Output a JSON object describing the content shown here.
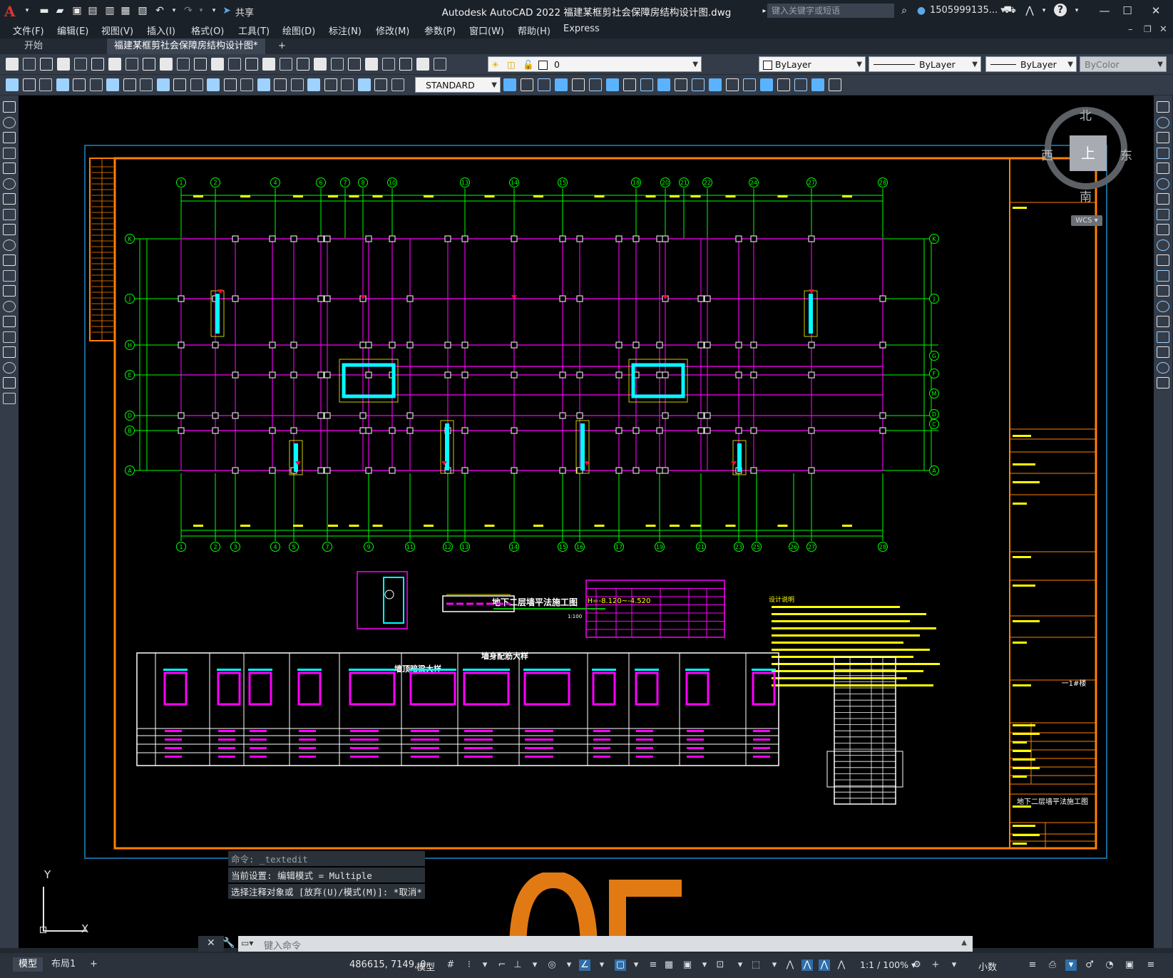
{
  "app": {
    "title": "Autodesk AutoCAD 2022    福建某框剪社会保障房结构设计图.dwg",
    "logo": "A",
    "share": "共享",
    "search_placeholder": "键入关键字或短语",
    "user": "1505999135... ▾",
    "help": "?"
  },
  "menu": [
    "文件(F)",
    "编辑(E)",
    "视图(V)",
    "插入(I)",
    "格式(O)",
    "工具(T)",
    "绘图(D)",
    "标注(N)",
    "修改(M)",
    "参数(P)",
    "窗口(W)",
    "帮助(H)",
    "Express"
  ],
  "tabs": {
    "start": "开始",
    "active": "福建某框剪社会保障房结构设计图*",
    "close": "✕",
    "add": "+"
  },
  "toolbar": {
    "layer_value": "0",
    "text_style": "STANDARD",
    "color": "ByLayer",
    "linetype": "ByLayer",
    "lineweight": "ByLayer",
    "plotstyle": "ByColor"
  },
  "viewcube": {
    "north": "北",
    "south": "南",
    "east": "东",
    "west": "西",
    "top": "上",
    "wcs": "WCS ▾"
  },
  "ucs": {
    "x": "X",
    "y": "Y"
  },
  "drawing": {
    "main_title": "地下二层墙平法施工图",
    "elevation": "H=-8.120~-4.520",
    "scale": "1:100",
    "detail1": "墙顶暗梁大样",
    "detail2": "墙身配筋大样",
    "design_notes_title": "设计说明",
    "titleblock_name": "地下二层墙平法施工图",
    "titleblock_building": "一1#楼",
    "grid_top": [
      "1",
      "2",
      "4",
      "6",
      "7",
      "8",
      "10",
      "13",
      "14",
      "15",
      "18",
      "20",
      "21",
      "22",
      "24",
      "27",
      "28"
    ],
    "grid_bottom": [
      "1",
      "2",
      "3",
      "4",
      "5",
      "7",
      "9",
      "11",
      "12",
      "13",
      "14",
      "15",
      "16",
      "17",
      "19",
      "21",
      "23",
      "25",
      "26",
      "27",
      "28"
    ],
    "grid_rows": [
      "K",
      "J",
      "H",
      "E",
      "D",
      "B",
      "A"
    ],
    "grid_rows_right": [
      "K",
      "J",
      "G",
      "F",
      "M",
      "D",
      "C",
      "A"
    ]
  },
  "command": {
    "history": [
      "命令: _textedit",
      "当前设置: 编辑模式 = Multiple",
      "选择注释对象或 [放弃(U)/模式(M)]: *取消*"
    ],
    "prompt": "键入命令"
  },
  "status": {
    "model_tab": "模型",
    "layout_tab": "布局1",
    "add_tab": "+",
    "coords": "486615, 7149, 0",
    "space": "模型",
    "annoscale": "1:1 / 100% ▾",
    "units": "小数"
  },
  "colors": {
    "background": "#000000",
    "grid_axis": "#00ff00",
    "beams": "#ff00ff",
    "border": "#ff8000",
    "walls": "#00ffff",
    "notes": "#ffff00"
  }
}
